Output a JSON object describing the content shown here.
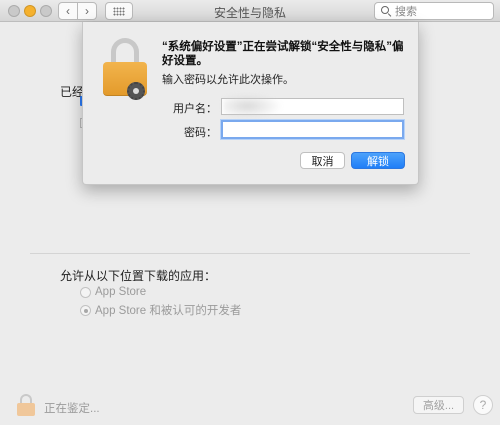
{
  "window": {
    "title": "安全性与隐私"
  },
  "toolbar": {
    "search_placeholder": "搜索",
    "back_glyph": "‹",
    "forward_glyph": "›"
  },
  "background": {
    "partial_label": "已经",
    "allow_label": "允许从以下位置下载的应用：",
    "options": [
      {
        "label": "App Store",
        "selected": false
      },
      {
        "label": "App Store 和被认可的开发者",
        "selected": true
      }
    ]
  },
  "bottom": {
    "status": "正在鉴定...",
    "advanced_label": "高级...",
    "help_label": "?"
  },
  "dialog": {
    "title": "“系统偏好设置”正在尝试解锁“安全性与隐私”偏好设置。",
    "subtitle": "输入密码以允许此次操作。",
    "username_label": "用户名：",
    "username_value": "",
    "password_label": "密码：",
    "password_value": "",
    "cancel_label": "取消",
    "unlock_label": "解锁"
  },
  "colors": {
    "accent": "#1f7ef7",
    "lock_orange": "#e9a43a",
    "traffic_yellow": "#f5b12e"
  }
}
